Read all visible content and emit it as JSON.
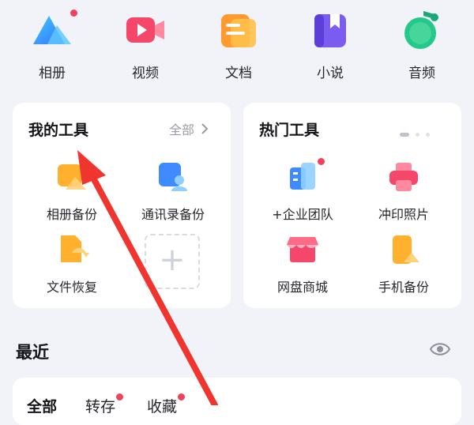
{
  "categories": [
    {
      "label": "相册",
      "icon": "album-icon",
      "badge": true
    },
    {
      "label": "视频",
      "icon": "video-icon",
      "badge": false
    },
    {
      "label": "文档",
      "icon": "document-icon",
      "badge": false
    },
    {
      "label": "小说",
      "icon": "novel-icon",
      "badge": false
    },
    {
      "label": "音频",
      "icon": "audio-icon",
      "badge": false
    }
  ],
  "my_tools": {
    "title": "我的工具",
    "more_label": "全部",
    "more_icon": "chevron-right-icon",
    "items": [
      {
        "label": "相册备份",
        "icon": "album-backup-icon"
      },
      {
        "label": "通讯录备份",
        "icon": "contacts-backup-icon"
      },
      {
        "label": "文件恢复",
        "icon": "file-recovery-icon"
      }
    ],
    "add_glyph": "+"
  },
  "hot_tools": {
    "title": "热门工具",
    "items": [
      {
        "label": "+企业团队",
        "icon": "enterprise-team-icon",
        "badge": true
      },
      {
        "label": "冲印照片",
        "icon": "print-photo-icon",
        "badge": false
      },
      {
        "label": "网盘商城",
        "icon": "store-icon",
        "badge": false
      },
      {
        "label": "手机备份",
        "icon": "phone-backup-icon",
        "badge": false
      }
    ]
  },
  "recent": {
    "title": "最近",
    "eye_icon": "eye-icon",
    "tabs": [
      {
        "label": "全部",
        "active": true,
        "badge": false
      },
      {
        "label": "转存",
        "active": false,
        "badge": true
      },
      {
        "label": "收藏",
        "active": false,
        "badge": true
      }
    ]
  },
  "colors": {
    "accent_red": "#f0425c",
    "arrow_red": "#f0352e",
    "muted": "#9a9ca6"
  }
}
